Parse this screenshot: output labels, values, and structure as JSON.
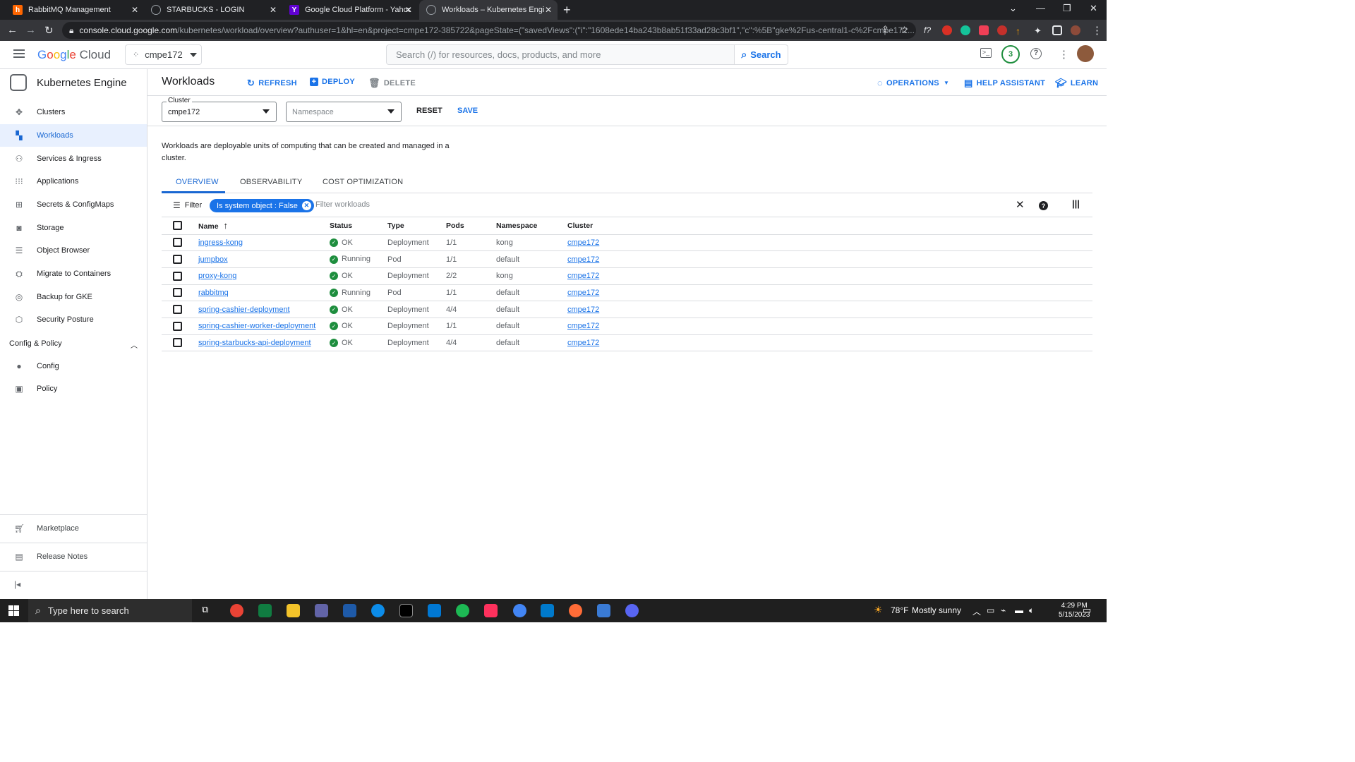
{
  "browser": {
    "tabs": [
      {
        "title": "RabbitMQ Management",
        "active": false
      },
      {
        "title": "STARBUCKS - LOGIN",
        "active": false
      },
      {
        "title": "Google Cloud Platform - Yahoo S",
        "active": false
      },
      {
        "title": "Workloads – Kubernetes Engine",
        "active": true
      }
    ],
    "url_domain": "console.cloud.google.com",
    "url_path": "/kubernetes/workload/overview?authuser=1&hl=en&project=cmpe172-385722&pageState=(\"savedViews\":(\"i\":\"1608ede14ba243b8ab51f33ad28c3bf1\",\"c\":%5B\"gke%2Fus-central1-c%2Fcmpe172...",
    "notification_count": "3"
  },
  "header": {
    "logo": "Google Cloud",
    "project": "cmpe172",
    "search_placeholder": "Search (/) for resources, docs, products, and more",
    "search_button": "Search"
  },
  "sidebar": {
    "product": "Kubernetes Engine",
    "items": [
      {
        "label": "Clusters",
        "icon": "clusters-icon",
        "active": false
      },
      {
        "label": "Workloads",
        "icon": "workloads-icon",
        "active": true
      },
      {
        "label": "Services & Ingress",
        "icon": "services-icon",
        "active": false
      },
      {
        "label": "Applications",
        "icon": "applications-icon",
        "active": false
      },
      {
        "label": "Secrets & ConfigMaps",
        "icon": "secrets-icon",
        "active": false
      },
      {
        "label": "Storage",
        "icon": "storage-icon",
        "active": false
      },
      {
        "label": "Object Browser",
        "icon": "object-browser-icon",
        "active": false
      },
      {
        "label": "Migrate to Containers",
        "icon": "migrate-icon",
        "active": false
      },
      {
        "label": "Backup for GKE",
        "icon": "backup-icon",
        "active": false
      },
      {
        "label": "Security Posture",
        "icon": "security-icon",
        "active": false
      }
    ],
    "section": "Config & Policy",
    "section_items": [
      {
        "label": "Config",
        "icon": "config-icon"
      },
      {
        "label": "Policy",
        "icon": "policy-icon"
      }
    ],
    "footer": [
      {
        "label": "Marketplace",
        "icon": "marketplace-icon"
      },
      {
        "label": "Release Notes",
        "icon": "release-notes-icon"
      }
    ]
  },
  "toolbar": {
    "title": "Workloads",
    "refresh": "REFRESH",
    "deploy": "DEPLOY",
    "delete": "DELETE",
    "operations": "OPERATIONS",
    "help_assistant": "HELP ASSISTANT",
    "learn": "LEARN"
  },
  "filters": {
    "cluster_label": "Cluster",
    "cluster_value": "cmpe172",
    "namespace_placeholder": "Namespace",
    "reset": "RESET",
    "save": "SAVE"
  },
  "description": "Workloads are deployable units of computing that can be created and managed in a cluster.",
  "tabs": [
    "OVERVIEW",
    "OBSERVABILITY",
    "COST OPTIMIZATION"
  ],
  "filterbar": {
    "label": "Filter",
    "chip": "Is system object : False",
    "placeholder": "Filter workloads"
  },
  "table": {
    "columns": [
      "Name",
      "Status",
      "Type",
      "Pods",
      "Namespace",
      "Cluster"
    ],
    "rows": [
      {
        "name": "ingress-kong",
        "status": "OK",
        "type": "Deployment",
        "pods": "1/1",
        "namespace": "kong",
        "cluster": "cmpe172"
      },
      {
        "name": "jumpbox",
        "status": "Running",
        "type": "Pod",
        "pods": "1/1",
        "namespace": "default",
        "cluster": "cmpe172"
      },
      {
        "name": "proxy-kong",
        "status": "OK",
        "type": "Deployment",
        "pods": "2/2",
        "namespace": "kong",
        "cluster": "cmpe172"
      },
      {
        "name": "rabbitmq",
        "status": "Running",
        "type": "Pod",
        "pods": "1/1",
        "namespace": "default",
        "cluster": "cmpe172"
      },
      {
        "name": "spring-cashier-deployment",
        "status": "OK",
        "type": "Deployment",
        "pods": "4/4",
        "namespace": "default",
        "cluster": "cmpe172"
      },
      {
        "name": "spring-cashier-worker-deployment",
        "status": "OK",
        "type": "Deployment",
        "pods": "1/1",
        "namespace": "default",
        "cluster": "cmpe172"
      },
      {
        "name": "spring-starbucks-api-deployment",
        "status": "OK",
        "type": "Deployment",
        "pods": "4/4",
        "namespace": "default",
        "cluster": "cmpe172"
      }
    ]
  },
  "taskbar": {
    "search_placeholder": "Type here to search",
    "weather_temp": "78°F",
    "weather_text": "Mostly sunny",
    "time": "4:29 PM",
    "date": "5/15/2023"
  },
  "colors": {
    "accent": "#1a73e8",
    "ok": "#1e8e3e",
    "active_bg": "#e8f0fe"
  }
}
